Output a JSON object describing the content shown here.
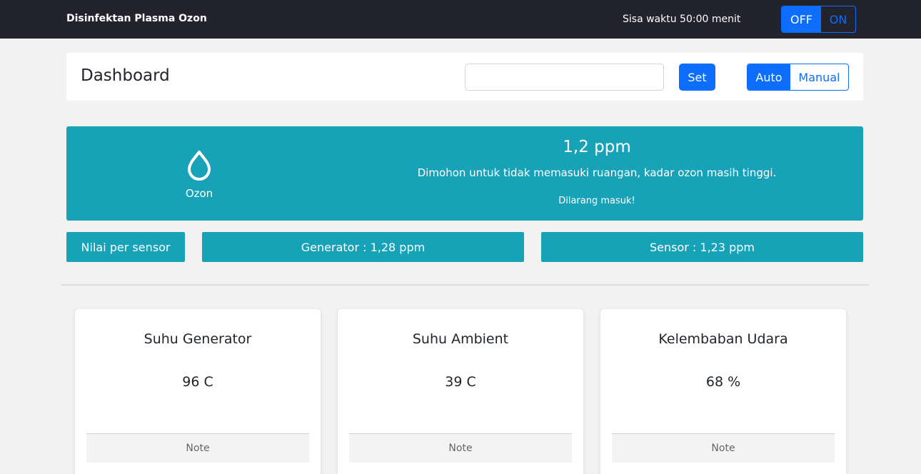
{
  "navbar": {
    "brand": "Disinfektan Plasma Ozon",
    "timer": "Sisa waktu 50:00 menit",
    "toggle": {
      "off_label": "OFF",
      "on_label": "ON",
      "active": "OFF"
    }
  },
  "dashboard": {
    "title": "Dashboard",
    "input_value": "",
    "set_label": "Set",
    "mode": {
      "auto_label": "Auto",
      "manual_label": "Manual",
      "active": "Auto"
    }
  },
  "ozone": {
    "icon": "droplet-icon",
    "label": "Ozon",
    "ppm": "1,2 ppm",
    "warning": "Dimohon untuk tidak memasuki ruangan, kadar ozon masih tinggi.",
    "banner": "Dilarang masuk!"
  },
  "sensors": {
    "header": "Nilai per sensor",
    "generator": "Generator : 1,28 ppm",
    "sensor": "Sensor : 1,23 ppm"
  },
  "cards": [
    {
      "title": "Suhu Generator",
      "value": "96 C",
      "note": "Note"
    },
    {
      "title": "Suhu Ambient",
      "value": "39 C",
      "note": "Note"
    },
    {
      "title": "Kelembaban Udara",
      "value": "68 %",
      "note": "Note"
    }
  ],
  "colors": {
    "navbar_bg": "#22232d",
    "primary": "#0d6efd",
    "info": "#17a2b8",
    "page_bg": "#f2f2f2"
  }
}
